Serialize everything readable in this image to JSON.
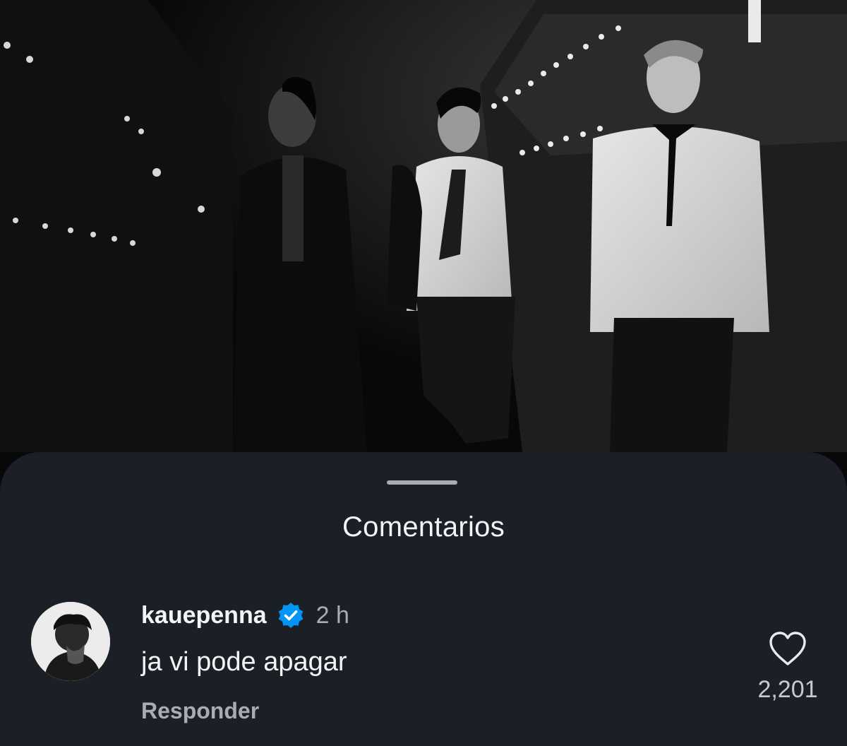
{
  "sheet": {
    "title": "Comentarios"
  },
  "comment": {
    "username": "kauepenna",
    "time": "2 h",
    "text": "ja vi pode apagar",
    "reply_label": "Responder",
    "like_count": "2,201",
    "verified": true
  },
  "colors": {
    "sheet_bg": "#1b2027",
    "verified_blue": "#0095f6",
    "text_primary": "#f2f4f6",
    "text_secondary": "#a8adb3"
  },
  "icons": {
    "verified": "verified-badge-icon",
    "like": "heart-outline-icon"
  }
}
